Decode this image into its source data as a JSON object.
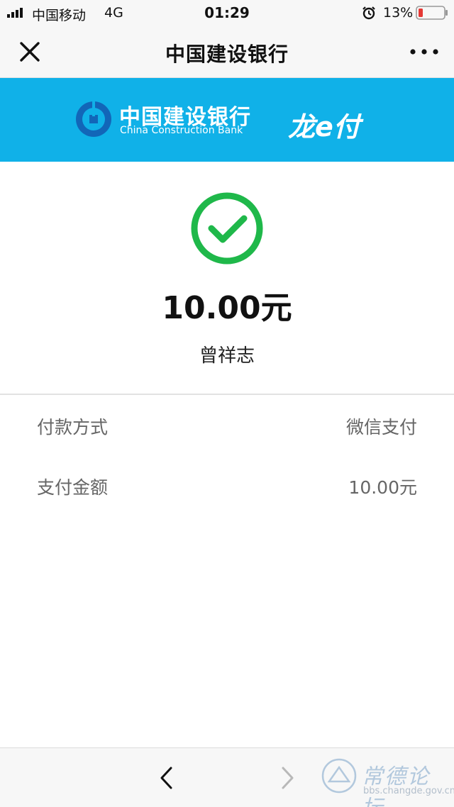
{
  "status_bar": {
    "carrier": "中国移动",
    "network": "4G",
    "time": "01:29",
    "battery": "13%"
  },
  "nav": {
    "title": "中国建设银行",
    "close_icon": "close-icon",
    "more_icon": "more-icon"
  },
  "banner": {
    "bank_name_cn": "中国建设银行",
    "bank_name_en": "China Construction Bank",
    "brand": "龙e付",
    "background": "#10b1e8"
  },
  "result": {
    "icon": "success-check-icon",
    "icon_color": "#1fb84a",
    "amount": "10.00元",
    "payee": "曾祥志"
  },
  "details": [
    {
      "label": "付款方式",
      "value": "微信支付"
    },
    {
      "label": "支付金额",
      "value": "10.00元"
    }
  ],
  "watermark": {
    "title": "常德论坛",
    "url": "bbs.changde.gov.cn"
  }
}
